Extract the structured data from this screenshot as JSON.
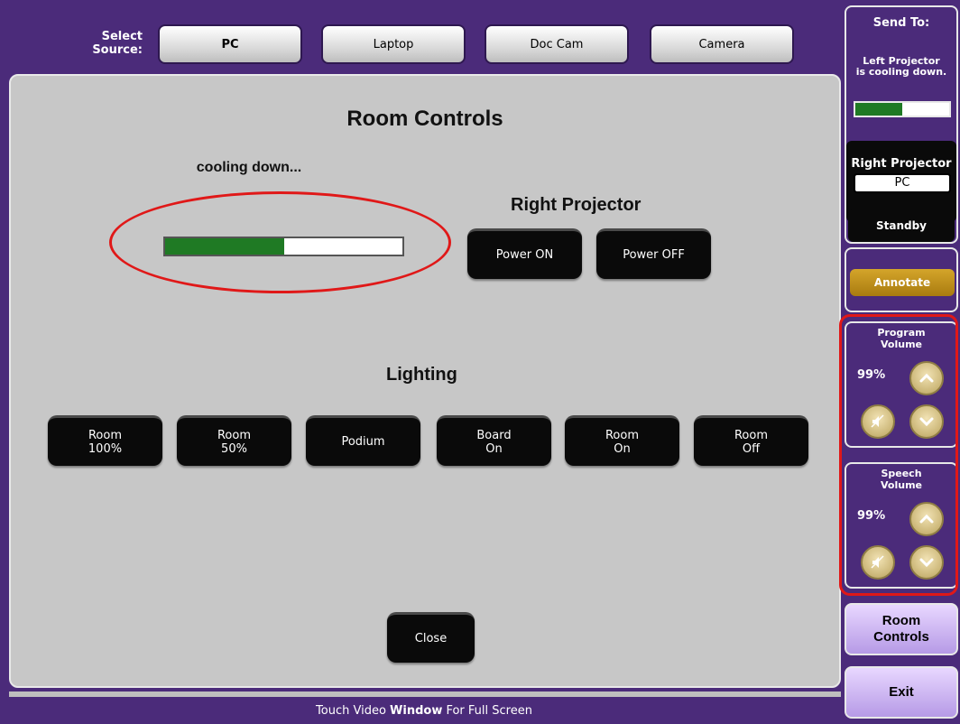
{
  "header": {
    "select_source_line1": "Select",
    "select_source_line2": "Source:",
    "sources": [
      {
        "label": "PC",
        "selected": true
      },
      {
        "label": "Laptop",
        "selected": false
      },
      {
        "label": "Doc Cam",
        "selected": false
      },
      {
        "label": "Camera",
        "selected": false
      }
    ]
  },
  "main": {
    "title": "Room Controls",
    "cooling": {
      "label": "cooling down...",
      "progress_percent": 50
    },
    "right_projector": {
      "title": "Right Projector",
      "power_on": "Power ON",
      "power_off": "Power OFF"
    },
    "lighting": {
      "title": "Lighting",
      "buttons": [
        {
          "line1": "Room",
          "line2": "100%"
        },
        {
          "line1": "Room",
          "line2": "50%"
        },
        {
          "line1": "Podium",
          "line2": ""
        },
        {
          "line1": "Board",
          "line2": "On"
        },
        {
          "line1": "Room",
          "line2": "On"
        },
        {
          "line1": "Room",
          "line2": "Off"
        }
      ]
    },
    "close": "Close"
  },
  "footer": {
    "prefix": "Touch Video ",
    "bold": "Window",
    "suffix": " For Full Screen"
  },
  "sidebar": {
    "send_to": "Send To:",
    "left_status_line1": "Left Projector",
    "left_status_line2": "is cooling down.",
    "left_progress_percent": 50,
    "right_projector_label": "Right Projector",
    "right_projector_value": "PC",
    "standby": "Standby",
    "annotate": "Annotate",
    "program_volume": {
      "line1": "Program",
      "line2": "Volume",
      "level": "99%"
    },
    "speech_volume": {
      "line1": "Speech",
      "line2": "Volume",
      "level": "99%"
    },
    "room_controls_line1": "Room",
    "room_controls_line2": "Controls",
    "exit": "Exit"
  },
  "colors": {
    "background": "#4b2b7a",
    "panel": "#c7c7c7",
    "progress": "#1f7a24",
    "highlight_ring": "#e01818",
    "annotate": "#c3961f"
  }
}
